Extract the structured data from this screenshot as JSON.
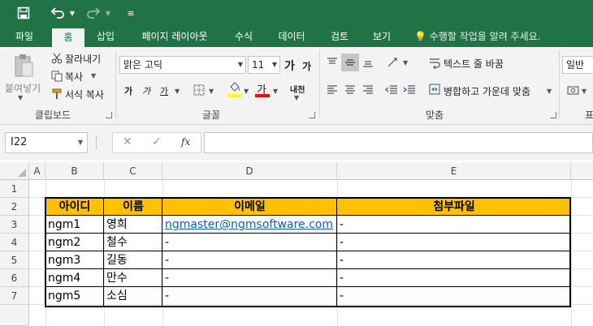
{
  "qat": {
    "save_icon": "save-icon",
    "undo_icon": "undo-icon",
    "redo_icon": "redo-icon",
    "customize_icon": "customize-qat-icon"
  },
  "tabs": [
    {
      "label": "파일"
    },
    {
      "label": "홈"
    },
    {
      "label": "삽입"
    },
    {
      "label": "페이지 레이아웃"
    },
    {
      "label": "수식"
    },
    {
      "label": "데이터"
    },
    {
      "label": "검토"
    },
    {
      "label": "보기"
    }
  ],
  "tell_me": "수행할 작업을 알려 주세요.",
  "ribbon": {
    "clipboard": {
      "paste": "붙여넣기",
      "cut": "잘라내기",
      "copy": "복사",
      "format_painter": "서식 복사",
      "group_label": "클립보드"
    },
    "font": {
      "font_name": "맑은 고딕",
      "font_size": "11",
      "grow": "가",
      "shrink": "가",
      "bold": "가",
      "italic": "가",
      "underline": "가",
      "font_color_glyph": "가",
      "phonetic": "내천",
      "group_label": "글꼴"
    },
    "alignment": {
      "wrap_text": "텍스트 줄 바꿈",
      "merge_center": "병합하고 가운데 맞춤",
      "group_label": "맞춤"
    },
    "number": {
      "format": "일반",
      "group_label_partial": "표"
    }
  },
  "formula_bar": {
    "name_box": "I22",
    "cancel": "✕",
    "enter": "✓",
    "fx": "fx",
    "formula": ""
  },
  "sheet": {
    "columns": [
      "A",
      "B",
      "C",
      "D",
      "E"
    ],
    "rows": [
      "1",
      "2",
      "3",
      "4",
      "5",
      "6",
      "7"
    ],
    "table_header": [
      "아이디",
      "이름",
      "이메일",
      "첨부파일"
    ],
    "table_rows": [
      [
        "ngm1",
        "영희",
        "ngmaster@ngmsoftware.com",
        "-"
      ],
      [
        "ngm2",
        "철수",
        "-",
        "-"
      ],
      [
        "ngm3",
        "길동",
        "-",
        "-"
      ],
      [
        "ngm4",
        "만수",
        "-",
        "-"
      ],
      [
        "ngm5",
        "소심",
        "-",
        "-"
      ]
    ]
  },
  "colors": {
    "accent": "#217346",
    "header_fill": "#ffc000",
    "link": "#0563c1",
    "font_color_bar": "#ff0000",
    "highlight_bar": "#ffff00"
  }
}
